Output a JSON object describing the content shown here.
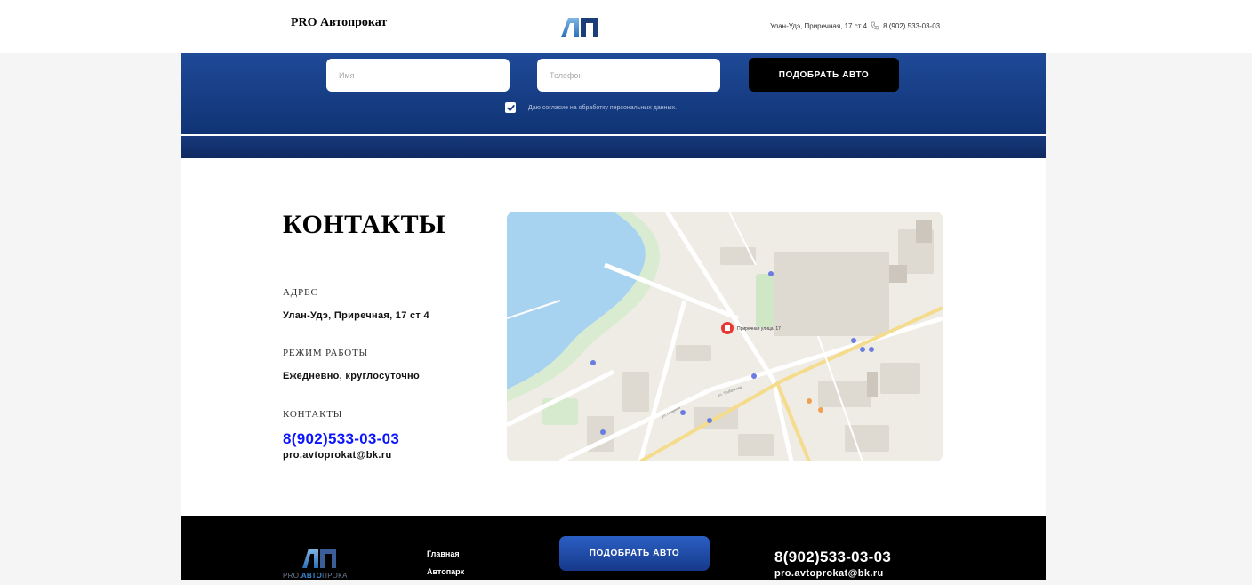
{
  "header": {
    "brand": "PRO Автопрокат",
    "contact_text": "Улан-Удэ, Приречная, 17 ст 4",
    "phone": "8 (902) 533-03-03",
    "logo_icon": "ap-logo-icon",
    "phone_icon": "phone-icon"
  },
  "form": {
    "name_placeholder": "Имя",
    "phone_placeholder": "Телефон",
    "submit_label": "ПОДОБРАТЬ АВТО",
    "consent_label": "Даю согласие на обработку персональных данных.",
    "consent_checked": true
  },
  "contacts": {
    "title": "КОНТАКТЫ",
    "address_label": "АДРЕС",
    "address_value": "Улан-Удэ, Приречная, 17 ст 4",
    "hours_label": "РЕЖИМ РАБОТЫ",
    "hours_value": "Ежедневно, круглосуточно",
    "contacts_label": "КОНТАКТЫ",
    "phone": "8(902)533-03-03",
    "email": "pro.avtoprokat@bk.ru"
  },
  "map": {
    "marker_label": "Приречная улица, 17",
    "street_labels": [
      "ул. Гагарина",
      "ул. Трубачеева"
    ]
  },
  "footer": {
    "logo_parts": [
      "PRO.",
      "АВТО",
      "ПРОКАТ"
    ],
    "nav": [
      "Главная",
      "Автопарк"
    ],
    "button_label": "ПОДОБРАТЬ АВТО",
    "phone": "8(902)533-03-03",
    "email": "pro.avtoprokat@bk.ru"
  },
  "colors": {
    "band_top": "#1f4a98",
    "band_bottom": "#103374",
    "accent_phone": "#0a14ff",
    "footer_bg": "#000000"
  }
}
